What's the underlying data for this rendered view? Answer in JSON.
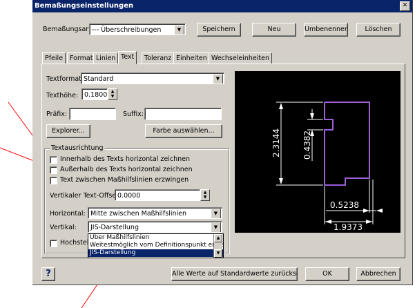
{
  "window": {
    "title": "Bemaßungseinstellungen"
  },
  "top": {
    "style_label": "Bemaßungsart:",
    "style_value": "--- Überschreibungen",
    "save_label": "Speichern",
    "new_label": "Neu",
    "rename_label": "Umbenennen",
    "delete_label": "Löschen"
  },
  "tabs": [
    "Pfeile",
    "Format",
    "Linien",
    "Text",
    "Toleranz",
    "Einheiten",
    "Wechseleinheiten"
  ],
  "text_tab": {
    "format_label": "Textformat:",
    "format_value": "Standard",
    "height_label": "Texthöhe:",
    "height_value": "0.1800",
    "prefix_label": "Präfix:",
    "prefix_value": "",
    "suffix_label": "Suffix:",
    "suffix_value": "",
    "explorer_label": "Explorer...",
    "color_label": "Farbe auswählen...",
    "alignment_group": "Textausrichtung",
    "cb_inside": "Innerhalb des Texts horizontal zeichnen",
    "cb_outside": "Außerhalb des Texts horizontal zeichnen",
    "cb_force": "Text zwischen Maßhilfslinien erzwingen",
    "offset_label": "Vertikaler Text-Offset:",
    "offset_value": "0.0000",
    "horizontal_label": "Horizontal:",
    "horizontal_value": "Mitte zwischen Maßhilfslinien",
    "vertical_label": "Vertikal:",
    "vertical_value": "JIS-Darstellung",
    "hochstell_label": "Hochstell"
  },
  "dropdown_list": {
    "options": [
      "Über Maßhilfslinien",
      "Weitestmöglich vom Definitionspunkt entfer",
      "JIS-Darstellung"
    ],
    "selected_index": 2
  },
  "preview": {
    "dim_vertical_1": "2.3144",
    "dim_vertical_2": "0.4382",
    "dim_horizontal_1": "0.5238",
    "dim_horizontal_2": "1.9373",
    "line_color": "#ffffff",
    "shape_color": "#9b5fd6"
  },
  "bottom": {
    "help_label": "?",
    "reset_label": "Alle Werte auf Standardwerte zurücksetzen",
    "ok_label": "OK",
    "cancel_label": "Abbrechen"
  },
  "annotations": {
    "arrow_color": "#ff0000"
  }
}
